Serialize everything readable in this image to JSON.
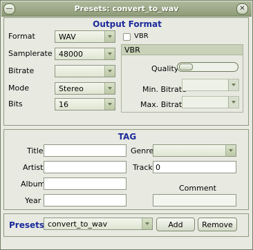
{
  "window": {
    "title": "Presets: convert_to_wav"
  },
  "output_format": {
    "title": "Output Format",
    "format": {
      "label": "Format",
      "value": "WAV"
    },
    "samplerate": {
      "label": "Samplerate",
      "value": "48000"
    },
    "bitrate": {
      "label": "Bitrate",
      "value": ""
    },
    "mode": {
      "label": "Mode",
      "value": "Stereo"
    },
    "bits": {
      "label": "Bits",
      "value": "16"
    },
    "vbr": {
      "checkbox_label": "VBR",
      "checked": false,
      "group_title": "VBR",
      "quality_label": "Quality",
      "quality_level": 0,
      "min_bitrate_label": "Min. Bitrate",
      "min_bitrate_value": "",
      "max_bitrate_label": "Max. Bitrate",
      "max_bitrate_value": ""
    }
  },
  "tag": {
    "title": "TAG",
    "title_label": "Title",
    "title_value": "",
    "artist_label": "Artist",
    "artist_value": "",
    "album_label": "Album",
    "album_value": "",
    "year_label": "Year",
    "year_value": "",
    "genre_label": "Genre",
    "genre_value": "",
    "track_label": "Track",
    "track_value": "0",
    "comment_label": "Comment",
    "comment_value": ""
  },
  "presets": {
    "label": "Presets",
    "value": "convert_to_wav",
    "add_label": "Add",
    "remove_label": "Remove"
  },
  "colors": {
    "section_title": "#1b2a9a",
    "titlebar": "#9aa585"
  },
  "icons": {
    "menu": "dash-icon",
    "close": "close-icon",
    "dropdown": "chevron-down-icon"
  }
}
